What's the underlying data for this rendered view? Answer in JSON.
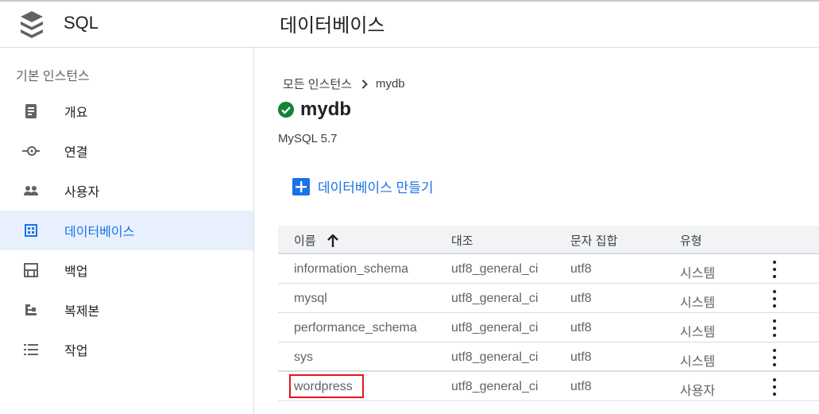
{
  "header": {
    "product_name": "SQL",
    "page_title": "데이터베이스"
  },
  "sidebar": {
    "section_label": "기본 인스턴스",
    "items": [
      {
        "label": "개요",
        "icon": "overview-icon",
        "active": false
      },
      {
        "label": "연결",
        "icon": "connections-icon",
        "active": false
      },
      {
        "label": "사용자",
        "icon": "users-icon",
        "active": false
      },
      {
        "label": "데이터베이스",
        "icon": "databases-icon",
        "active": true
      },
      {
        "label": "백업",
        "icon": "backups-icon",
        "active": false
      },
      {
        "label": "복제본",
        "icon": "replicas-icon",
        "active": false
      },
      {
        "label": "작업",
        "icon": "operations-icon",
        "active": false
      }
    ]
  },
  "breadcrumb": {
    "root": "모든 인스턴스",
    "current": "mydb"
  },
  "instance": {
    "name": "mydb",
    "status": "running",
    "version": "MySQL 5.7"
  },
  "actions": {
    "create_database": "데이터베이스 만들기"
  },
  "table": {
    "columns": [
      "이름",
      "대조",
      "문자 집합",
      "유형"
    ],
    "sort_column": "이름",
    "sort_direction": "ascending",
    "rows": [
      {
        "name": "information_schema",
        "collation": "utf8_general_ci",
        "charset": "utf8",
        "type": "시스템"
      },
      {
        "name": "mysql",
        "collation": "utf8_general_ci",
        "charset": "utf8",
        "type": "시스템"
      },
      {
        "name": "performance_schema",
        "collation": "utf8_general_ci",
        "charset": "utf8",
        "type": "시스템"
      },
      {
        "name": "sys",
        "collation": "utf8_general_ci",
        "charset": "utf8",
        "type": "시스템"
      },
      {
        "name": "wordpress",
        "collation": "utf8_general_ci",
        "charset": "utf8",
        "type": "사용자",
        "highlighted": true
      }
    ]
  },
  "colors": {
    "accent": "#1a73e8",
    "status_ok": "#188038",
    "highlight": "#e8121b"
  }
}
